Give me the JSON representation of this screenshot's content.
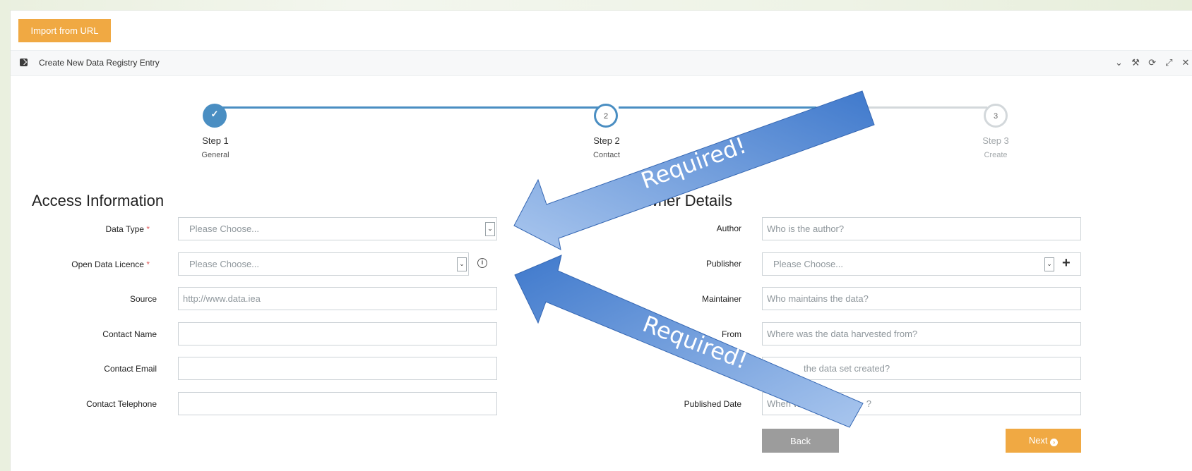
{
  "toolbar": {
    "import_label": "Import from URL"
  },
  "window": {
    "title": "Create New Data Registry Entry",
    "tools": [
      "⌄",
      "⚒",
      "⟳",
      "⤢",
      "✕"
    ]
  },
  "wizard": {
    "steps": [
      {
        "number": "✓",
        "label": "Step 1",
        "sub": "General",
        "state": "complete"
      },
      {
        "number": "2",
        "label": "Step 2",
        "sub": "Contact",
        "state": "active"
      },
      {
        "number": "3",
        "label": "Step 3",
        "sub": "Create",
        "state": "pending"
      }
    ],
    "accent": "#4a8ec2"
  },
  "access": {
    "title": "Access Information",
    "data_type": {
      "label": "Data Type",
      "required": "*",
      "value": "Please Choose..."
    },
    "licence": {
      "label": "Open Data Licence",
      "required": "*",
      "value": "Please Choose..."
    },
    "source": {
      "label": "Source",
      "placeholder": "http://www.data.iea"
    },
    "contact_name": {
      "label": "Contact Name",
      "value": ""
    },
    "contact_email": {
      "label": "Contact Email",
      "value": ""
    },
    "contact_phone": {
      "label": "Contact Telephone",
      "value": ""
    }
  },
  "owner": {
    "title_visible": "wner Details",
    "author": {
      "label": "Author",
      "placeholder": "Who is the author?"
    },
    "publisher": {
      "label": "Publisher",
      "value": "Please Choose..."
    },
    "maintainer": {
      "label": "Maintainer",
      "placeholder": "Who maintains the data?"
    },
    "harvested": {
      "label_visible": "From",
      "placeholder": "Where was the data harvested from?"
    },
    "created": {
      "label_visible": "Create",
      "placeholder_visible": "the data set created?"
    },
    "published": {
      "label": "Published Date",
      "placeholder_visible": "When was",
      "placeholder_tail": "?"
    }
  },
  "buttons": {
    "back": "Back",
    "next": "Next"
  },
  "annotations": {
    "arrow_text_1": "Required!",
    "arrow_text_2": "Required!",
    "arrow_color": "#4a80cf"
  }
}
